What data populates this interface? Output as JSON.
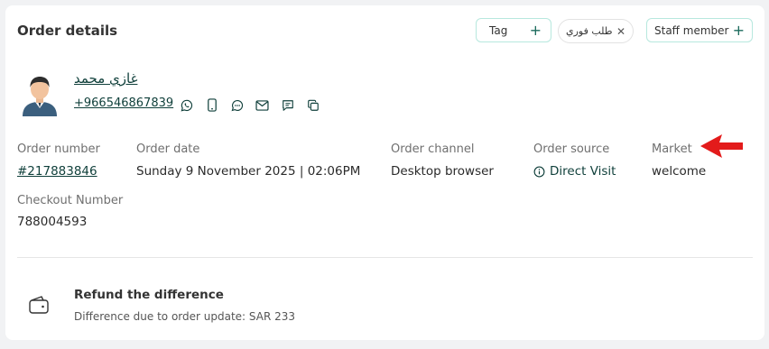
{
  "header": {
    "title": "Order details",
    "tag_label": "Tag",
    "urgent_label": "طلب فوري",
    "staff_label": "Staff member"
  },
  "customer": {
    "name": "غازي محمد",
    "phone": "+966546867839",
    "contact_icons": [
      "whatsapp-icon",
      "mobile-icon",
      "chat-bubble-icon",
      "mail-icon",
      "message-icon",
      "copy-icon"
    ]
  },
  "order": {
    "number_label": "Order number",
    "number_value": "#217883846",
    "date_label": "Order date",
    "date_value": "Sunday 9 November 2025 | 02:06PM",
    "channel_label": "Order channel",
    "channel_value": "Desktop browser",
    "source_label": "Order source",
    "source_value": "Direct Visit",
    "market_label": "Market",
    "market_value": "welcome",
    "checkout_label": "Checkout Number",
    "checkout_value": "788004593"
  },
  "refund": {
    "title": "Refund the difference",
    "description": "Difference due to order update: SAR 233"
  },
  "colors": {
    "accent_teal": "#0f3f3a",
    "chip_border": "#b7e8de",
    "arrow_red": "#e31b1b"
  }
}
